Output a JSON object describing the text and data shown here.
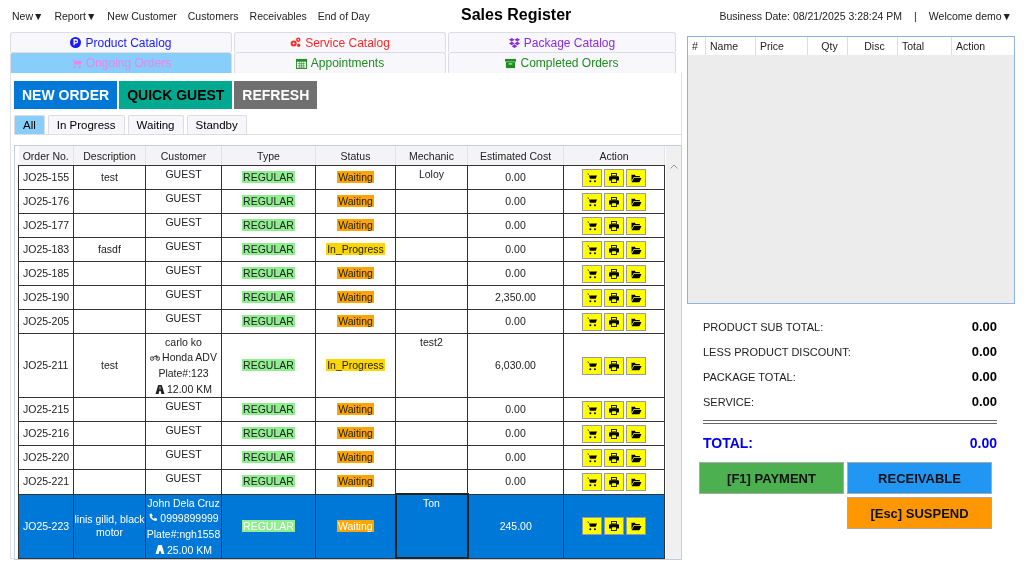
{
  "nav": [
    {
      "label": "New",
      "caret": "▼"
    },
    {
      "label": "Report",
      "caret": "▼"
    },
    {
      "label": "New Customer"
    },
    {
      "label": "Customers"
    },
    {
      "label": "Receivables"
    },
    {
      "label": "End of Day"
    }
  ],
  "title": "Sales Register",
  "business_date": "Business Date: 08/21/2025 3:28:24 PM",
  "separator": "|",
  "user": {
    "label": "Welcome demo",
    "caret": "▼"
  },
  "tabs": [
    {
      "label": "Product Catalog",
      "selected": false,
      "color": "#1a1aff"
    },
    {
      "label": "Service Catalog",
      "selected": false,
      "color": "#ff2a2a"
    },
    {
      "label": "Package Catalog",
      "selected": false,
      "color": "#8a2be2"
    },
    {
      "label": "Ongoing Orders",
      "selected": true,
      "color": "#ee82ee"
    },
    {
      "label": "Appointments",
      "selected": false,
      "color": "#1e8c1e"
    },
    {
      "label": "Completed Orders",
      "selected": false,
      "color": "#1e8c1e"
    }
  ],
  "actions": [
    {
      "label": "NEW ORDER",
      "color": "#0078d7"
    },
    {
      "label": "QUICK GUEST",
      "color": "#00a98f"
    },
    {
      "label": "REFRESH",
      "color": "#707070"
    }
  ],
  "filters": [
    {
      "label": "All",
      "selected": true
    },
    {
      "label": "In Progress",
      "selected": false
    },
    {
      "label": "Waiting",
      "selected": false
    },
    {
      "label": "Standby",
      "selected": false
    }
  ],
  "orders": {
    "columns": [
      "Order No.",
      "Description",
      "Customer",
      "Type",
      "Status",
      "Mechanic",
      "Estimated Cost",
      "Action"
    ],
    "rows": [
      {
        "order": "JO25-155",
        "description": "test",
        "customer": [
          {
            "kind": "name",
            "text": "GUEST"
          }
        ],
        "type": "REGULAR",
        "status": {
          "text": "Waiting",
          "color": "#ffa500"
        },
        "mechanic": "Loloy",
        "cost": "0.00",
        "selected": false
      },
      {
        "order": "JO25-176",
        "customer": [
          {
            "kind": "name",
            "text": "GUEST"
          }
        ],
        "type": "REGULAR",
        "status": {
          "text": "Waiting",
          "color": "#ffa500"
        },
        "cost": "0.00",
        "selected": false
      },
      {
        "order": "JO25-177",
        "customer": [
          {
            "kind": "name",
            "text": "GUEST"
          }
        ],
        "type": "REGULAR",
        "status": {
          "text": "Waiting",
          "color": "#ffa500"
        },
        "cost": "0.00",
        "selected": false
      },
      {
        "order": "JO25-183",
        "description": "fasdf",
        "customer": [
          {
            "kind": "name",
            "text": "GUEST"
          }
        ],
        "type": "REGULAR",
        "status": {
          "text": "In_Progress",
          "color": "#ffd700"
        },
        "cost": "0.00",
        "selected": false
      },
      {
        "order": "JO25-185",
        "customer": [
          {
            "kind": "name",
            "text": "GUEST"
          }
        ],
        "type": "REGULAR",
        "status": {
          "text": "Waiting",
          "color": "#ffa500"
        },
        "cost": "0.00",
        "selected": false
      },
      {
        "order": "JO25-190",
        "customer": [
          {
            "kind": "name",
            "text": "GUEST"
          }
        ],
        "type": "REGULAR",
        "status": {
          "text": "Waiting",
          "color": "#ffa500"
        },
        "cost": "2,350.00",
        "selected": false
      },
      {
        "order": "JO25-205",
        "customer": [
          {
            "kind": "name",
            "text": "GUEST"
          }
        ],
        "type": "REGULAR",
        "status": {
          "text": "Waiting",
          "color": "#ffa500"
        },
        "cost": "0.00",
        "selected": false
      },
      {
        "order": "JO25-211",
        "description": "test",
        "customer": [
          {
            "kind": "name",
            "text": "carlo ko"
          },
          {
            "kind": "vehicle",
            "text": "Honda ADV"
          },
          {
            "kind": "plate",
            "text": "Plate#:123"
          },
          {
            "kind": "mileage",
            "text": "12.00 KM"
          }
        ],
        "type": "REGULAR",
        "status": {
          "text": "In_Progress",
          "color": "#ffd700"
        },
        "mechanic": "test2",
        "cost": "6,030.00",
        "selected": false
      },
      {
        "order": "JO25-215",
        "customer": [
          {
            "kind": "name",
            "text": "GUEST"
          }
        ],
        "type": "REGULAR",
        "status": {
          "text": "Waiting",
          "color": "#ffa500"
        },
        "cost": "0.00",
        "selected": false
      },
      {
        "order": "JO25-216",
        "customer": [
          {
            "kind": "name",
            "text": "GUEST"
          }
        ],
        "type": "REGULAR",
        "status": {
          "text": "Waiting",
          "color": "#ffa500"
        },
        "cost": "0.00",
        "selected": false
      },
      {
        "order": "JO25-220",
        "customer": [
          {
            "kind": "name",
            "text": "GUEST"
          }
        ],
        "type": "REGULAR",
        "status": {
          "text": "Waiting",
          "color": "#ffa500"
        },
        "cost": "0.00",
        "selected": false
      },
      {
        "order": "JO25-221",
        "customer": [
          {
            "kind": "name",
            "text": "GUEST"
          }
        ],
        "type": "REGULAR",
        "status": {
          "text": "Waiting",
          "color": "#ffa500"
        },
        "cost": "0.00",
        "selected": false
      },
      {
        "order": "JO25-223",
        "description": "linis gilid, black motor",
        "customer": [
          {
            "kind": "name",
            "text": "John Dela Cruz"
          },
          {
            "kind": "phone",
            "text": "0999899999"
          },
          {
            "kind": "plate",
            "text": "Plate#:ngh1558"
          },
          {
            "kind": "mileage",
            "text": "25.00 KM"
          }
        ],
        "type": "REGULAR",
        "status": {
          "text": "Waiting",
          "color": "#ffa500"
        },
        "mechanic": "Ton",
        "cost": "245.00",
        "selected": true
      }
    ]
  },
  "cart": {
    "columns": [
      "#",
      "Name",
      "Price",
      "Qty",
      "Disc",
      "Total",
      "Action"
    ]
  },
  "summary": [
    {
      "label": "PRODUCT SUB TOTAL:",
      "value": "0.00"
    },
    {
      "label": "LESS PRODUCT DISCOUNT:",
      "value": "0.00"
    },
    {
      "label": "PACKAGE TOTAL:",
      "value": "0.00"
    },
    {
      "label": "SERVICE:",
      "value": "0.00"
    }
  ],
  "total": {
    "label": "TOTAL:",
    "value": "0.00"
  },
  "checkout": [
    {
      "label": "[F1] PAYMENT",
      "color": "#4caf50"
    },
    {
      "label": "RECEIVABLE",
      "color": "#2196f3"
    },
    {
      "label": "[Esc] SUSPEND",
      "color": "#ff9800"
    }
  ]
}
